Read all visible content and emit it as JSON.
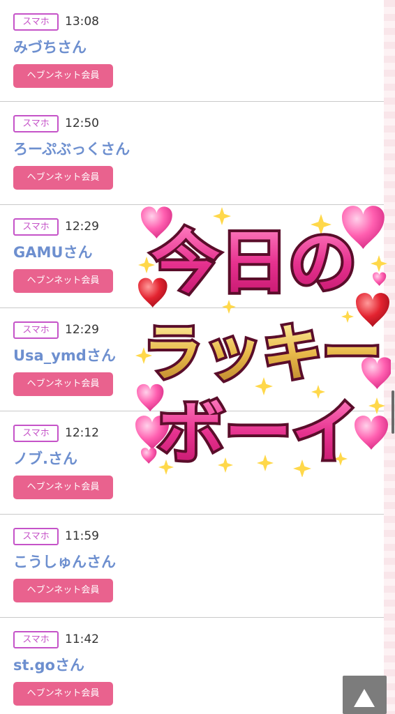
{
  "visitors": [
    {
      "device": "スマホ",
      "time": "13:08",
      "name": "みづちさん",
      "member": "ヘブンネット会員"
    },
    {
      "device": "スマホ",
      "time": "12:50",
      "name": "ろーぷぶっくさん",
      "member": "ヘブンネット会員"
    },
    {
      "device": "スマホ",
      "time": "12:29",
      "name": "GAMUさん",
      "member": "ヘブンネット会員"
    },
    {
      "device": "スマホ",
      "time": "12:29",
      "name": "Usa_ymdさん",
      "member": "ヘブンネット会員"
    },
    {
      "device": "スマホ",
      "time": "12:12",
      "name": "ノブ.さん",
      "member": "ヘブンネット会員"
    },
    {
      "device": "スマホ",
      "time": "11:59",
      "name": "こうしゅんさん",
      "member": "ヘブンネット会員"
    },
    {
      "device": "スマホ",
      "time": "11:42",
      "name": "st.goさん",
      "member": "ヘブンネット会員"
    }
  ],
  "sticker": {
    "line1": "今日の",
    "line2": "ラッキー",
    "line3": "ボーイ"
  },
  "back_to_top_icon": "triangle-up-icon",
  "colors": {
    "badge": "#c553c8",
    "name": "#6d8fcf",
    "member_button": "#e9628e"
  }
}
